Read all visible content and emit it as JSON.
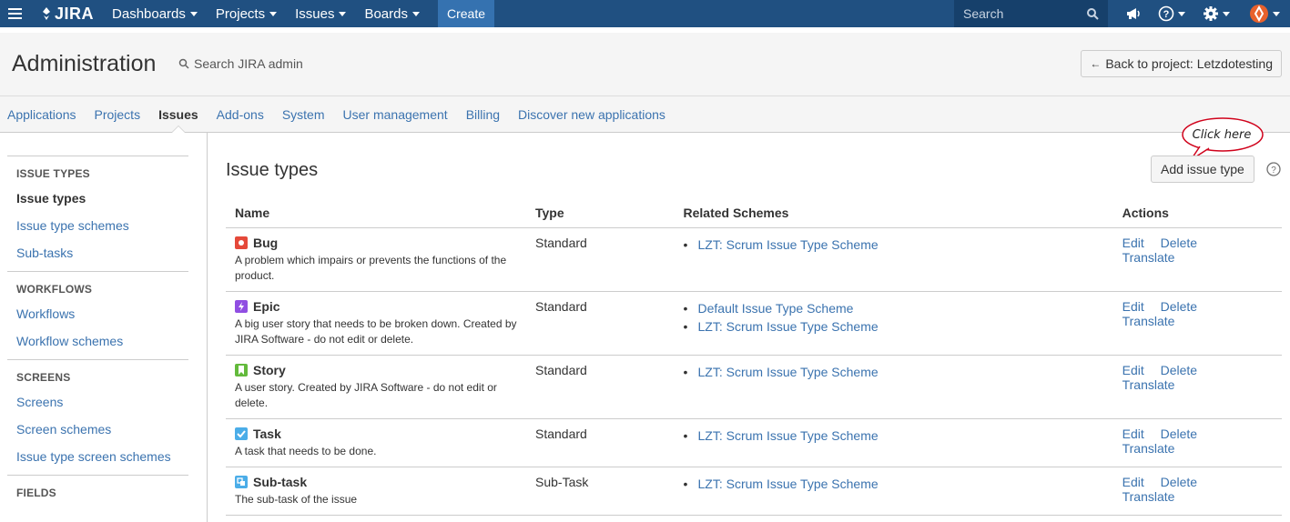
{
  "topnav": {
    "logo_text": "JIRA",
    "menus": [
      {
        "label": "Dashboards"
      },
      {
        "label": "Projects"
      },
      {
        "label": "Issues"
      },
      {
        "label": "Boards"
      }
    ],
    "create_label": "Create",
    "search_placeholder": "Search",
    "icons": [
      "notifications-icon",
      "help-icon",
      "settings-icon",
      "avatar"
    ]
  },
  "header": {
    "title": "Administration",
    "search_label": "Search JIRA admin",
    "back_button": "Back to project: Letzdotesting"
  },
  "tabs": [
    {
      "label": "Applications",
      "active": false
    },
    {
      "label": "Projects",
      "active": false
    },
    {
      "label": "Issues",
      "active": true
    },
    {
      "label": "Add-ons",
      "active": false
    },
    {
      "label": "System",
      "active": false
    },
    {
      "label": "User management",
      "active": false
    },
    {
      "label": "Billing",
      "active": false
    },
    {
      "label": "Discover new applications",
      "active": false
    }
  ],
  "sidebar": {
    "sections": [
      {
        "heading": "ISSUE TYPES",
        "items": [
          {
            "label": "Issue types",
            "active": true
          },
          {
            "label": "Issue type schemes",
            "active": false
          },
          {
            "label": "Sub-tasks",
            "active": false
          }
        ]
      },
      {
        "heading": "WORKFLOWS",
        "items": [
          {
            "label": "Workflows",
            "active": false
          },
          {
            "label": "Workflow schemes",
            "active": false
          }
        ]
      },
      {
        "heading": "SCREENS",
        "items": [
          {
            "label": "Screens",
            "active": false
          },
          {
            "label": "Screen schemes",
            "active": false
          },
          {
            "label": "Issue type screen schemes",
            "active": false
          }
        ]
      },
      {
        "heading": "FIELDS",
        "items": []
      }
    ]
  },
  "main": {
    "title": "Issue types",
    "add_button": "Add issue type",
    "callout_text": "Click here",
    "columns": {
      "name": "Name",
      "type": "Type",
      "schemes": "Related Schemes",
      "actions": "Actions"
    },
    "action_labels": {
      "edit": "Edit",
      "delete": "Delete",
      "translate": "Translate"
    },
    "rows": [
      {
        "name": "Bug",
        "icon": "bug-icon",
        "color": "#e5493a",
        "description": "A problem which impairs or prevents the functions of the product.",
        "type": "Standard",
        "schemes": [
          "LZT: Scrum Issue Type Scheme"
        ]
      },
      {
        "name": "Epic",
        "icon": "epic-icon",
        "color": "#904ee2",
        "description": "A big user story that needs to be broken down. Created by JIRA Software - do not edit or delete.",
        "type": "Standard",
        "schemes": [
          "Default Issue Type Scheme",
          "LZT: Scrum Issue Type Scheme"
        ]
      },
      {
        "name": "Story",
        "icon": "story-icon",
        "color": "#63ba3c",
        "description": "A user story. Created by JIRA Software - do not edit or delete.",
        "type": "Standard",
        "schemes": [
          "LZT: Scrum Issue Type Scheme"
        ]
      },
      {
        "name": "Task",
        "icon": "task-icon",
        "color": "#4bade8",
        "description": "A task that needs to be done.",
        "type": "Standard",
        "schemes": [
          "LZT: Scrum Issue Type Scheme"
        ]
      },
      {
        "name": "Sub-task",
        "icon": "subtask-icon",
        "color": "#4bade8",
        "description": "The sub-task of the issue",
        "type": "Sub-Task",
        "schemes": [
          "LZT: Scrum Issue Type Scheme"
        ]
      }
    ]
  },
  "colors": {
    "nav_bg": "#205081",
    "link": "#3b73af",
    "callout_border": "#d0021b"
  }
}
